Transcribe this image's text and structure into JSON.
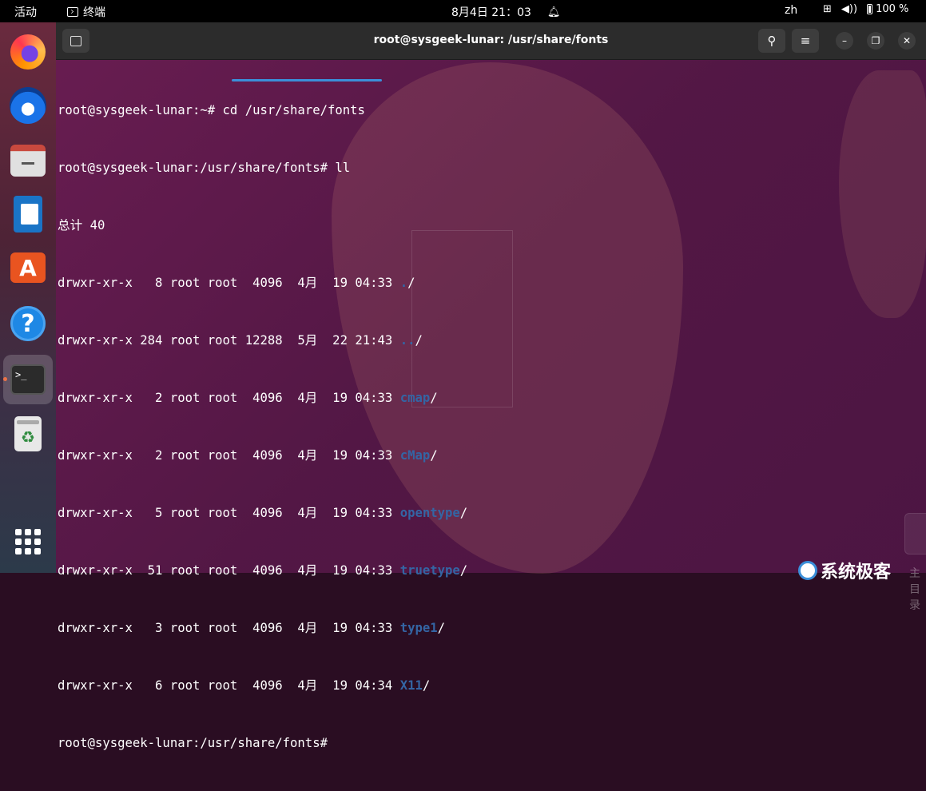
{
  "topbar": {
    "activities": "活动",
    "app_name": "终端",
    "clock": "8月4日  21：03",
    "lang": "zh",
    "battery": "100 %"
  },
  "dock": {
    "items": [
      "firefox",
      "thunderbird",
      "files",
      "libreoffice-writer",
      "app-center",
      "help",
      "terminal",
      "trash"
    ]
  },
  "window": {
    "title": "root@sysgeek-lunar: /usr/share/fonts"
  },
  "terminal": {
    "lines": [
      {
        "prompt": "root@sysgeek-lunar:~# ",
        "cmd": "cd /usr/share/fonts"
      },
      {
        "prompt": "root@sysgeek-lunar:/usr/share/fonts# ",
        "cmd": "ll"
      },
      {
        "text": "总计 40"
      },
      {
        "text": "drwxr-xr-x   8 root root  4096  4月  19 04:33 ",
        "dir": ".",
        "tail": "/"
      },
      {
        "text": "drwxr-xr-x 284 root root 12288  5月  22 21:43 ",
        "dir": "..",
        "tail": "/"
      },
      {
        "text": "drwxr-xr-x   2 root root  4096  4月  19 04:33 ",
        "dir": "cmap",
        "tail": "/"
      },
      {
        "text": "drwxr-xr-x   2 root root  4096  4月  19 04:33 ",
        "dir": "cMap",
        "tail": "/"
      },
      {
        "text": "drwxr-xr-x   5 root root  4096  4月  19 04:33 ",
        "dir": "opentype",
        "tail": "/"
      },
      {
        "text": "drwxr-xr-x  51 root root  4096  4月  19 04:33 ",
        "dir": "truetype",
        "tail": "/"
      },
      {
        "text": "drwxr-xr-x   3 root root  4096  4月  19 04:33 ",
        "dir": "type1",
        "tail": "/"
      },
      {
        "text": "drwxr-xr-x   6 root root  4096  4月  19 04:34 ",
        "dir": "X11",
        "tail": "/"
      },
      {
        "prompt": "root@sysgeek-lunar:/usr/share/fonts# ",
        "cmd": ""
      }
    ]
  },
  "watermark": {
    "logo": "系统极客",
    "sub": "主目录"
  },
  "colors": {
    "dir": "#3465a4",
    "accent": "#e95420",
    "underline": "#3b8fd9"
  }
}
